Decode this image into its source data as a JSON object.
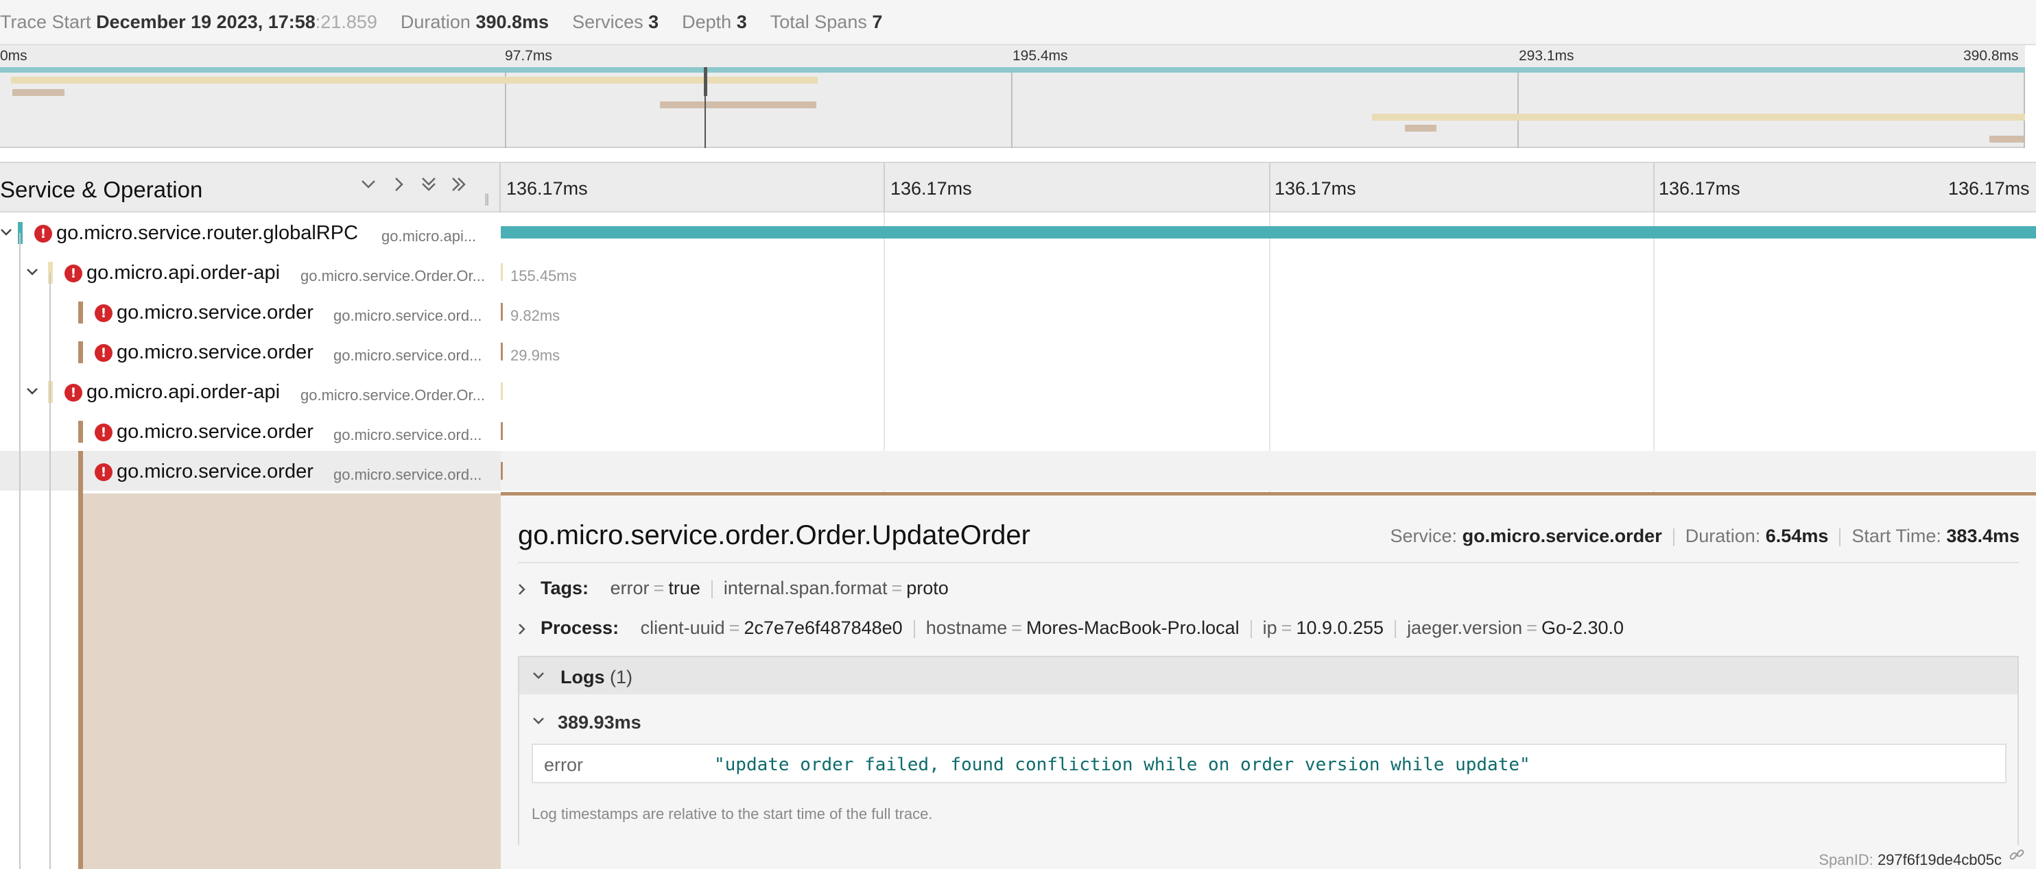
{
  "trace_header": {
    "trace_start_label": "Trace Start",
    "trace_start_value": "December 19 2023, 17:58",
    "trace_start_seconds": ":21.859",
    "duration_label": "Duration",
    "duration_value": "390.8ms",
    "services_label": "Services",
    "services_value": "3",
    "depth_label": "Depth",
    "depth_value": "3",
    "total_spans_label": "Total Spans",
    "total_spans_value": "7"
  },
  "minimap": {
    "ticks": [
      "0ms",
      "97.7ms",
      "195.4ms",
      "293.1ms",
      "390.8ms"
    ]
  },
  "timeline_header": {
    "title": "Service & Operation",
    "ticks": [
      "136.17ms",
      "136.17ms",
      "136.17ms",
      "136.17ms",
      "136.17ms"
    ],
    "icons": [
      "chevron-down-icon",
      "chevron-right-icon",
      "double-chevron-down-icon",
      "double-chevron-right-icon"
    ]
  },
  "colors": {
    "router": "#4bb0b5",
    "api": "#eedfb7",
    "order": "#b88d68",
    "error": "#d2262b",
    "log_value": "#0e6b6b"
  },
  "rows": [
    {
      "service": "go.micro.service.router.globalRPC",
      "operation": "go.micro.api...",
      "duration": ""
    },
    {
      "service": "go.micro.api.order-api",
      "operation": "go.micro.service.Order.Or...",
      "duration": "155.45ms"
    },
    {
      "service": "go.micro.service.order",
      "operation": "go.micro.service.ord...",
      "duration": "9.82ms"
    },
    {
      "service": "go.micro.service.order",
      "operation": "go.micro.service.ord...",
      "duration": "29.9ms"
    },
    {
      "service": "go.micro.api.order-api",
      "operation": "go.micro.service.Order.Or...",
      "duration": ""
    },
    {
      "service": "go.micro.service.order",
      "operation": "go.micro.service.ord...",
      "duration": ""
    },
    {
      "service": "go.micro.service.order",
      "operation": "go.micro.service.ord...",
      "duration": ""
    }
  ],
  "detail": {
    "title": "go.micro.service.order.Order.UpdateOrder",
    "service_label": "Service:",
    "service_value": "go.micro.service.order",
    "duration_label": "Duration:",
    "duration_value": "6.54ms",
    "start_label": "Start Time:",
    "start_value": "383.4ms",
    "tags_label": "Tags:",
    "tags": [
      {
        "key": "error",
        "value": "true"
      },
      {
        "key": "internal.span.format",
        "value": "proto"
      }
    ],
    "process_label": "Process:",
    "process": [
      {
        "key": "client-uuid",
        "value": "2c7e7e6f487848e0"
      },
      {
        "key": "hostname",
        "value": "Mores-MacBook-Pro.local"
      },
      {
        "key": "ip",
        "value": "10.9.0.255"
      },
      {
        "key": "jaeger.version",
        "value": "Go-2.30.0"
      }
    ],
    "logs_label": "Logs",
    "logs_count": "(1)",
    "log_timestamp": "389.93ms",
    "log_key": "error",
    "log_value": "\"update order failed, found confliction while on order version while update\"",
    "log_note": "Log timestamps are relative to the start time of the full trace.",
    "span_id_label": "SpanID:",
    "span_id_value": "297f6f19de4cb05c"
  }
}
